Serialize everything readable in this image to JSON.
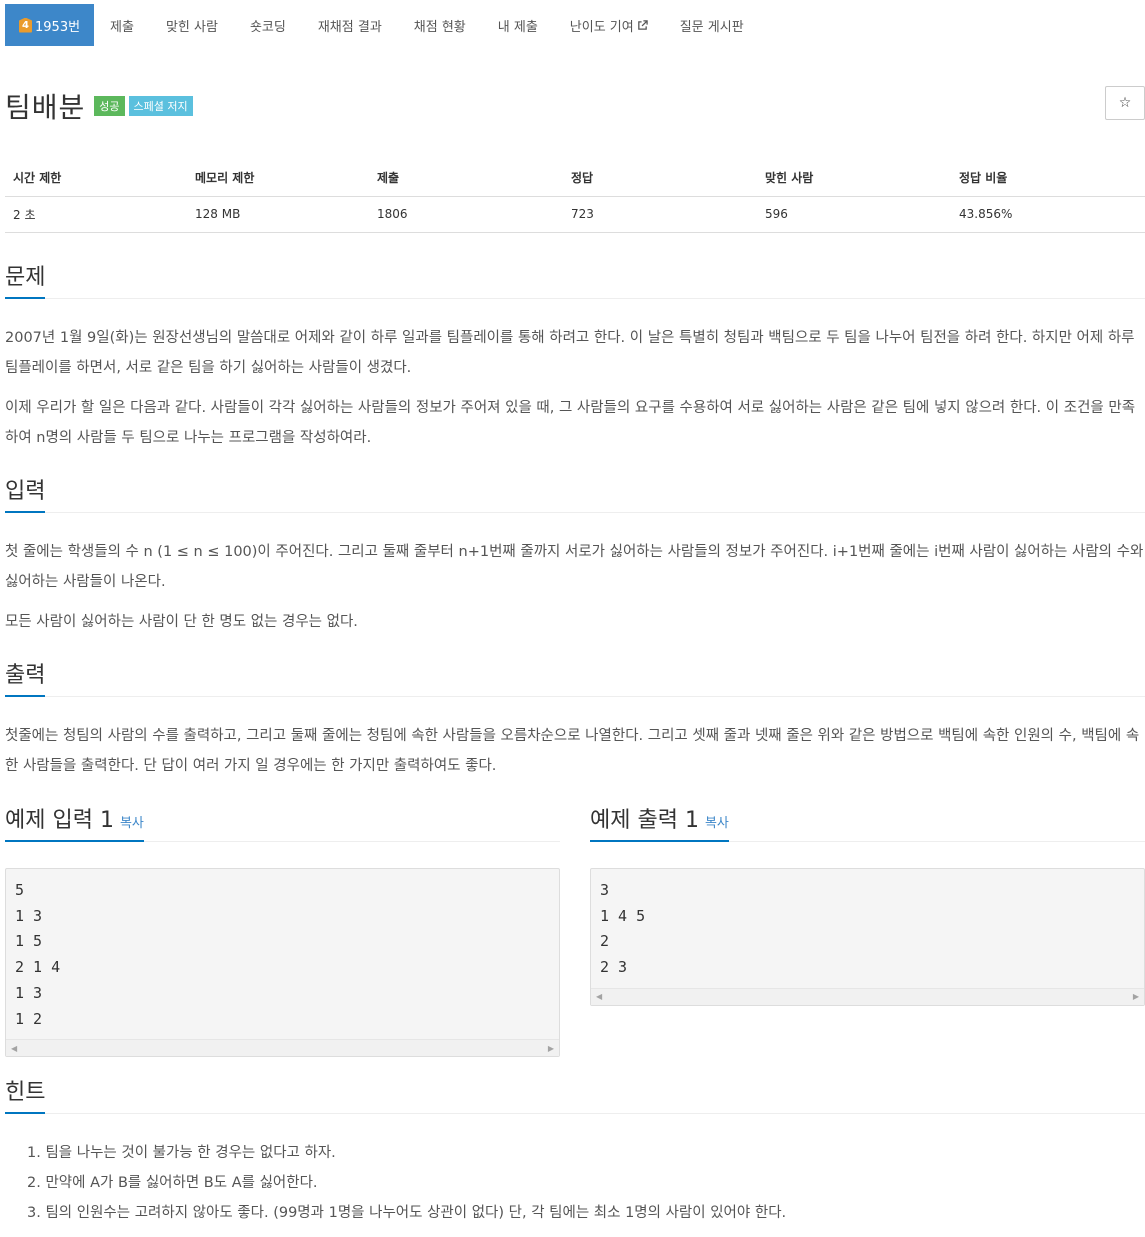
{
  "nav": {
    "level_badge": "4",
    "problem_number": "1953번",
    "tabs": [
      "제출",
      "맞힌 사람",
      "숏코딩",
      "재채점 결과",
      "채점 현황",
      "내 제출"
    ],
    "difficulty_tab": "난이도 기여",
    "board_tab": "질문 게시판"
  },
  "title": {
    "text": "팀배분",
    "labels": [
      "성공",
      "스페셜 저지"
    ],
    "star": "☆"
  },
  "info": {
    "headers": [
      "시간 제한",
      "메모리 제한",
      "제출",
      "정답",
      "맞힌 사람",
      "정답 비율"
    ],
    "values": [
      "2 초",
      "128 MB",
      "1806",
      "723",
      "596",
      "43.856%"
    ]
  },
  "problem": {
    "heading": "문제",
    "paragraphs": [
      "2007년 1월 9일(화)는 원장선생님의 말씀대로 어제와 같이 하루 일과를 팀플레이를 통해 하려고 한다. 이 날은 특별히 청팀과 백팀으로 두 팀을 나누어 팀전을 하려 한다. 하지만 어제 하루 팀플레이를 하면서, 서로 같은 팀을 하기 싫어하는 사람들이 생겼다.",
      "이제 우리가 할 일은 다음과 같다. 사람들이 각각 싫어하는 사람들의 정보가 주어져 있을 때, 그 사람들의 요구를 수용하여 서로 싫어하는 사람은 같은 팀에 넣지 않으려 한다. 이 조건을 만족하여 n명의 사람들 두 팀으로 나누는 프로그램을 작성하여라."
    ]
  },
  "input": {
    "heading": "입력",
    "paragraphs": [
      "첫 줄에는 학생들의 수 n (1 ≤ n ≤ 100)이 주어진다. 그리고 둘째 줄부터 n+1번째 줄까지 서로가 싫어하는 사람들의 정보가 주어진다. i+1번째 줄에는 i번째 사람이 싫어하는 사람의 수와 싫어하는 사람들이 나온다.",
      "모든 사람이 싫어하는 사람이 단 한 명도 없는 경우는 없다."
    ]
  },
  "output": {
    "heading": "출력",
    "paragraphs": [
      "첫줄에는 청팀의 사람의 수를 출력하고, 그리고 둘째 줄에는 청팀에 속한 사람들을 오름차순으로 나열한다. 그리고 셋째 줄과 넷째 줄은 위와 같은 방법으로 백팀에 속한 인원의 수, 백팀에 속한 사람들을 출력한다. 단 답이 여러 가지 일 경우에는 한 가지만 출력하여도 좋다."
    ]
  },
  "sample_input": {
    "heading": "예제 입력 1",
    "copy": "복사",
    "text": "5\n1 3\n1 5\n2 1 4\n1 3\n1 2"
  },
  "sample_output": {
    "heading": "예제 출력 1",
    "copy": "복사",
    "text": "3\n1 4 5\n2\n2 3"
  },
  "hint": {
    "heading": "힌트",
    "items": [
      "1. 팀을 나누는 것이 불가능 한 경우는 없다고 하자.",
      "2. 만약에 A가 B를 싫어하면 B도 A를 싫어한다.",
      "3. 팀의 인원수는 고려하지 않아도 좋다. (99명과 1명을 나누어도 상관이 없다) 단, 각 팀에는 최소 1명의 사람이 있어야 한다."
    ]
  },
  "colors": {
    "active_tab": "#3d87c9",
    "success": "#5cb85c",
    "info": "#5bc0de",
    "link": "#3d87c9",
    "heading_underline": "#0076c0"
  }
}
